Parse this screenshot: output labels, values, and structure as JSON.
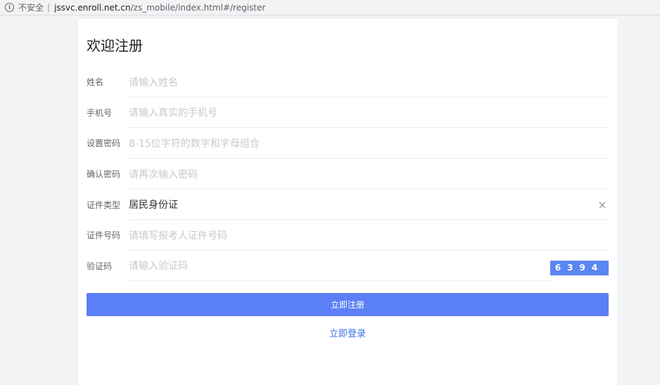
{
  "browser": {
    "security_label": "不安全",
    "separator": "|",
    "url_host": "jssvc.enroll.net.cn",
    "url_path": "/zs_mobile/index.html#/register"
  },
  "page": {
    "title": "欢迎注册",
    "fields": [
      {
        "label": "姓名",
        "placeholder": "请输入姓名"
      },
      {
        "label": "手机号",
        "placeholder": "请输入真实的手机号"
      },
      {
        "label": "设置密码",
        "placeholder": "8-15位字符的数字和字母组合"
      },
      {
        "label": "确认密码",
        "placeholder": "请再次输入密码"
      },
      {
        "label": "证件类型",
        "value": "居民身份证"
      },
      {
        "label": "证件号码",
        "placeholder": "请填写报考人证件号码"
      },
      {
        "label": "验证码",
        "placeholder": "请输入验证码",
        "captcha": "6394"
      }
    ],
    "submit_label": "立即注册",
    "login_label": "立即登录"
  },
  "colors": {
    "accent": "#5b7ff4",
    "link": "#3a6ee0"
  },
  "icons": {
    "info": "info-icon",
    "clear": "close-icon"
  }
}
